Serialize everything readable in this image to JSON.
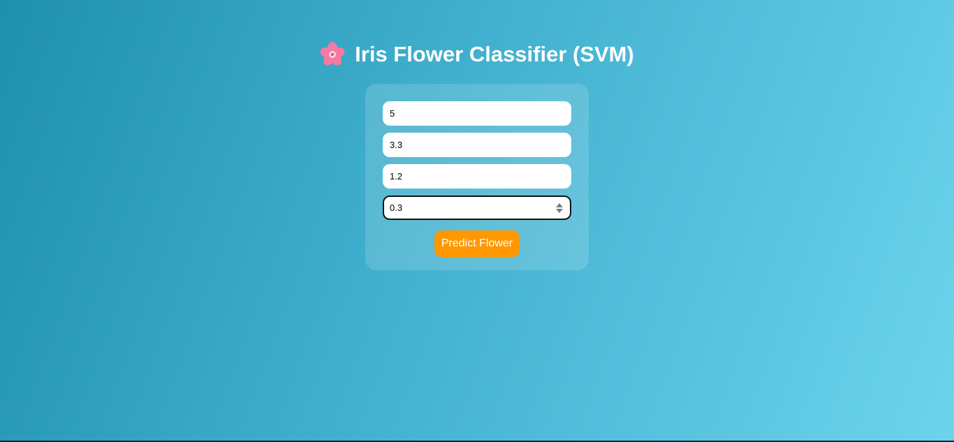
{
  "header": {
    "title": "Iris Flower Classifier (SVM)",
    "icon": "cherry-blossom-icon"
  },
  "form": {
    "fields": [
      {
        "value": "5"
      },
      {
        "value": "3.3"
      },
      {
        "value": "1.2"
      },
      {
        "value": "0.3"
      }
    ],
    "submit_label": "Predict Flower"
  },
  "colors": {
    "background_start": "#1f8faf",
    "background_end": "#6cd4ec",
    "button": "#ff9800",
    "title": "#ffffff"
  }
}
